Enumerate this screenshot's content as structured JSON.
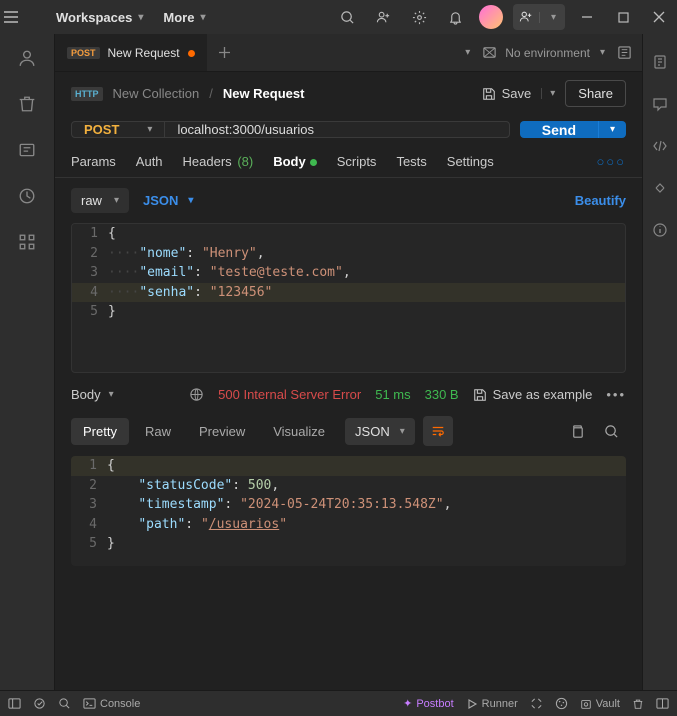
{
  "titlebar": {
    "workspaces": "Workspaces",
    "more": "More"
  },
  "tab": {
    "method_badge": "POST",
    "title": "New Request"
  },
  "env": {
    "label": "No environment"
  },
  "breadcrumb": {
    "http_badge": "HTTP",
    "collection": "New Collection",
    "current": "New Request",
    "save": "Save",
    "share": "Share"
  },
  "request": {
    "method": "POST",
    "url": "localhost:3000/usuarios",
    "send": "Send"
  },
  "req_tabs": {
    "params": "Params",
    "auth": "Auth",
    "headers": "Headers",
    "headers_count": "(8)",
    "body": "Body",
    "scripts": "Scripts",
    "tests": "Tests",
    "settings": "Settings"
  },
  "body_ctl": {
    "raw": "raw",
    "json": "JSON",
    "beautify": "Beautify"
  },
  "req_body": {
    "lines": [
      "1",
      "2",
      "3",
      "4",
      "5"
    ],
    "k_nome": "\"nome\"",
    "v_nome": "\"Henry\"",
    "k_email": "\"email\"",
    "v_email": "\"teste@teste.com\"",
    "k_senha": "\"senha\"",
    "v_senha": "\"123456\""
  },
  "response": {
    "body_label": "Body",
    "status_code": "500",
    "status_text": "Internal Server Error",
    "time": "51 ms",
    "size": "330 B",
    "save_example": "Save as example"
  },
  "resp_tabs": {
    "pretty": "Pretty",
    "raw": "Raw",
    "preview": "Preview",
    "visualize": "Visualize",
    "json": "JSON"
  },
  "resp_body": {
    "lines": [
      "1",
      "2",
      "3",
      "4",
      "5"
    ],
    "k_status": "\"statusCode\"",
    "v_status": "500",
    "k_ts": "\"timestamp\"",
    "v_ts": "\"2024-05-24T20:35:13.548Z\"",
    "k_path": "\"path\"",
    "v_path": "/usuarios"
  },
  "statusbar": {
    "console": "Console",
    "postbot": "Postbot",
    "runner": "Runner",
    "vault": "Vault"
  }
}
